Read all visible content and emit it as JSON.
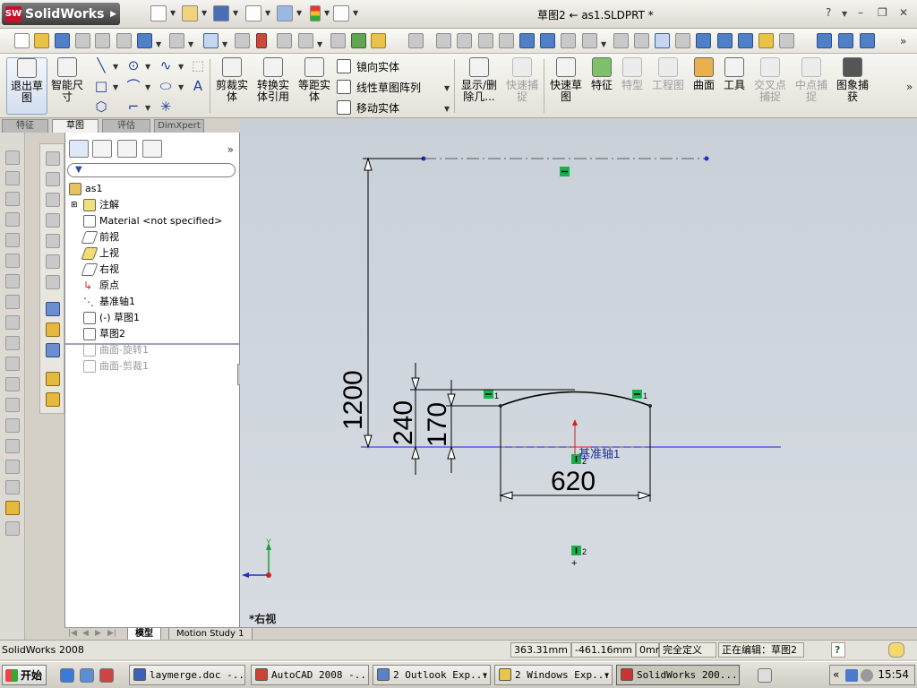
{
  "titlebar": {
    "app_name": "SolidWorks",
    "logo_mark": "SW",
    "document_title": "草图2 ← as1.SLDPRT *",
    "help_glyph": "?",
    "minimize": "–",
    "restore": "❐",
    "close": "✕"
  },
  "command_manager": {
    "exit_sketch": "退出草图",
    "smart_dimension": "智能尺寸",
    "trim_entities": "剪裁实体",
    "convert_entities": "转换实体引用",
    "offset_entities": "等距实体",
    "mirror_entities": "镜向实体",
    "linear_pattern": "线性草图阵列",
    "move_entities": "移动实体",
    "display_delete_relations": "显示/删除几...",
    "quick_snaps": "快速捕捉",
    "rapid_sketch": "快速草图",
    "features": "特征",
    "special_features": "特型",
    "drawings": "工程图",
    "surfaces": "曲面",
    "tools": "工具",
    "intersection_snap": "交叉点捕捉",
    "midpoint_snap": "中点捕捉",
    "image_capture": "图象捕获",
    "more": "»"
  },
  "cm_tabs": [
    "特征",
    "草图",
    "评估",
    "DimXpert"
  ],
  "feature_tree": {
    "part": "as1",
    "items": [
      "注解",
      "Material <not specified>",
      "前视",
      "上视",
      "右视",
      "原点",
      "基准轴1",
      "(-) 草图1",
      "草图2",
      "曲面-旋转1",
      "曲面-剪裁1"
    ],
    "expand": "»"
  },
  "sketch": {
    "dim_1200": "1200",
    "dim_240": "240",
    "dim_170": "170",
    "dim_620": "620",
    "axis_label": "基准轴1",
    "relation_1": "1",
    "relation_2": "2",
    "triad_y": "Y",
    "view_name": "*右视"
  },
  "bottom_tabs": [
    "模型",
    "Motion Study 1"
  ],
  "statusbar": {
    "product": "SolidWorks 2008",
    "x": "363.31mm",
    "y": "-461.16mm",
    "z": "0mm",
    "status": "完全定义",
    "editing": "正在编辑：草图2",
    "help": "?"
  },
  "taskbar": {
    "start": "开始",
    "tasks": [
      "laymerge.doc -...",
      "AutoCAD 2008 -...",
      "2 Outlook Exp...",
      "2 Windows Exp...",
      "SolidWorks 200..."
    ],
    "clock": "15:54",
    "tray_expand": "«"
  }
}
